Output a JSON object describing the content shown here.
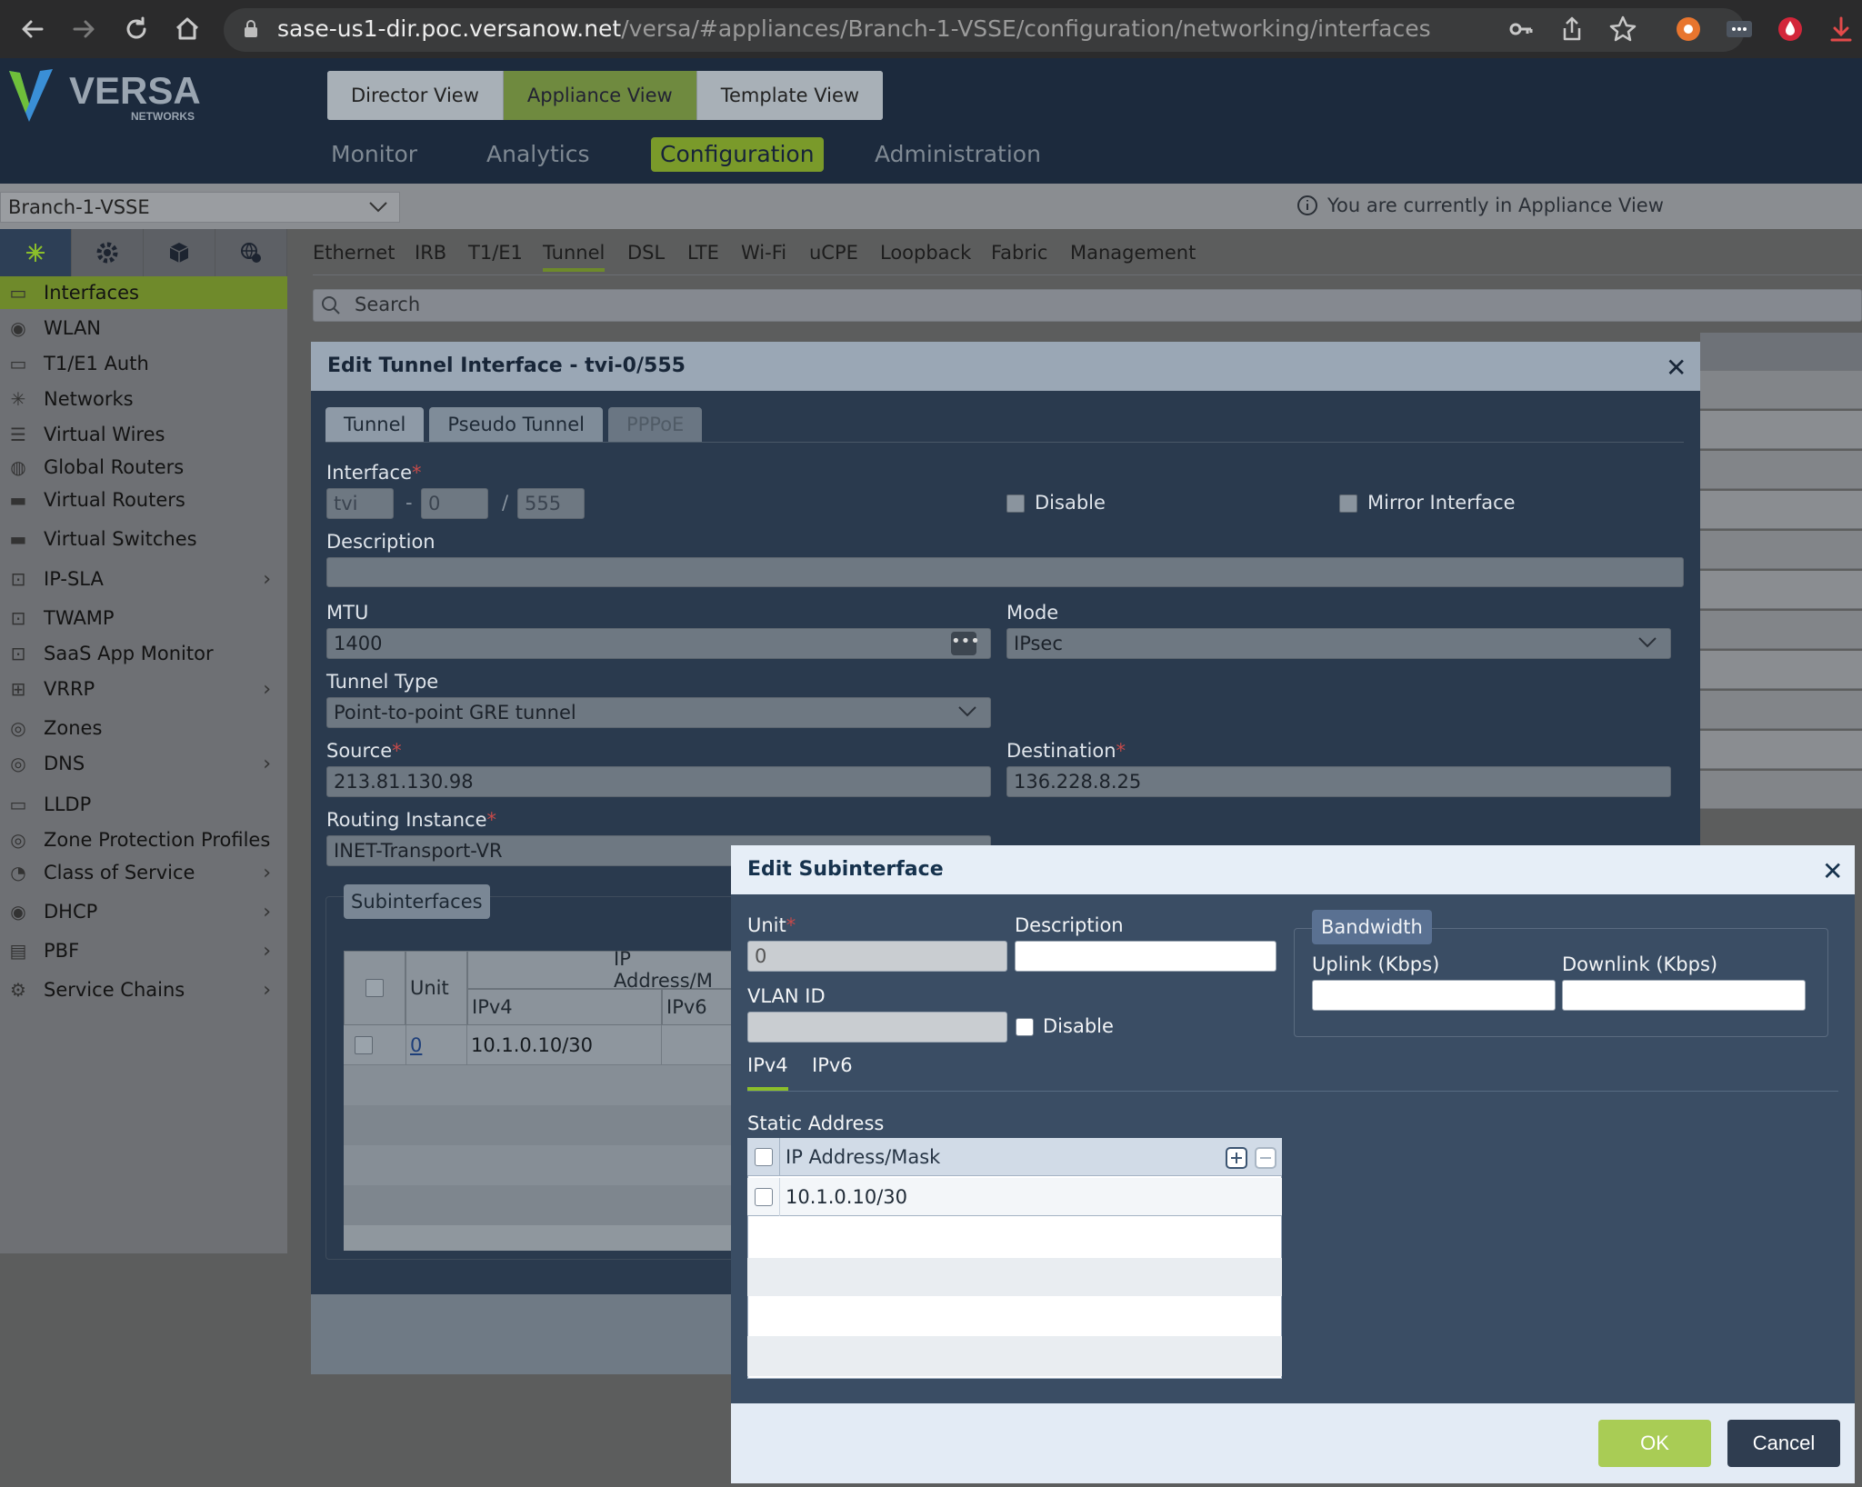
{
  "browser": {
    "url_host": "sase-us1-dir.poc.versanow.net",
    "url_path": "/versa/#appliances/Branch-1-VSSE/configuration/networking/interfaces"
  },
  "app": {
    "logo_text": "VERSA",
    "logo_sub": "NETWORKS",
    "views": [
      "Director View",
      "Appliance View",
      "Template View"
    ],
    "active_view": "Appliance View",
    "main_nav": [
      "Monitor",
      "Analytics",
      "Configuration",
      "Administration"
    ],
    "active_nav": "Configuration",
    "appliance": "Branch-1-VSSE",
    "notice": "You are currently in Appliance View"
  },
  "sidebar": {
    "icons": [
      "network-icon",
      "gear-icon",
      "cube-icon",
      "globe-gear-icon"
    ],
    "items": [
      {
        "label": "Interfaces",
        "active": true
      },
      {
        "label": "WLAN"
      },
      {
        "label": "T1/E1 Auth"
      },
      {
        "label": "Networks"
      },
      {
        "label": "Virtual Wires"
      },
      {
        "label": "Global Routers"
      },
      {
        "label": "Virtual Routers"
      },
      {
        "label": "Virtual Switches"
      },
      {
        "label": "IP-SLA",
        "expandable": true
      },
      {
        "label": "TWAMP"
      },
      {
        "label": "SaaS App Monitor"
      },
      {
        "label": "VRRP",
        "expandable": true
      },
      {
        "label": "Zones"
      },
      {
        "label": "DNS",
        "expandable": true
      },
      {
        "label": "LLDP"
      },
      {
        "label": "Zone Protection Profiles"
      },
      {
        "label": "Class of Service",
        "expandable": true
      },
      {
        "label": "DHCP",
        "expandable": true
      },
      {
        "label": "PBF",
        "expandable": true
      },
      {
        "label": "Service Chains",
        "expandable": true
      }
    ]
  },
  "content": {
    "tabs": [
      "Ethernet",
      "IRB",
      "T1/E1",
      "Tunnel",
      "DSL",
      "LTE",
      "Wi-Fi",
      "uCPE",
      "Loopback",
      "Fabric",
      "Management"
    ],
    "active_tab": "Tunnel",
    "search_placeholder": "Search"
  },
  "tunnel_dialog": {
    "title": "Edit Tunnel Interface - tvi-0/555",
    "tabs": [
      "Tunnel",
      "Pseudo Tunnel",
      "PPPoE"
    ],
    "interface_label": "Interface",
    "interface_prefix": "tvi",
    "interface_sep1": "-",
    "interface_slot": "0",
    "interface_sep2": "/",
    "interface_port": "555",
    "disable_label": "Disable",
    "mirror_label": "Mirror Interface",
    "description_label": "Description",
    "description_value": "",
    "mtu_label": "MTU",
    "mtu_value": "1400",
    "mode_label": "Mode",
    "mode_value": "IPsec",
    "tunnel_type_label": "Tunnel Type",
    "tunnel_type_value": "Point-to-point GRE tunnel",
    "source_label": "Source",
    "source_value": "213.81.130.98",
    "destination_label": "Destination",
    "destination_value": "136.228.8.25",
    "routing_label": "Routing Instance",
    "routing_value": "INET-Transport-VR",
    "subinterfaces_label": "Subinterfaces",
    "table": {
      "col_unit": "Unit",
      "col_ip_group": "IP Address/M",
      "col_ipv4": "IPv4",
      "col_ipv6": "IPv6",
      "rows": [
        {
          "unit": "0",
          "ipv4": "10.1.0.10/30",
          "ipv6": ""
        }
      ]
    }
  },
  "sub_dialog": {
    "title": "Edit Subinterface",
    "unit_label": "Unit",
    "unit_value": "0",
    "description_label": "Description",
    "vlan_label": "VLAN ID",
    "disable_label": "Disable",
    "bandwidth_label": "Bandwidth",
    "uplink_label": "Uplink (Kbps)",
    "downlink_label": "Downlink (Kbps)",
    "tabs": [
      "IPv4",
      "IPv6"
    ],
    "active_tab": "IPv4",
    "static_label": "Static Address",
    "table_header": "IP Address/Mask",
    "rows": [
      "10.1.0.10/30"
    ],
    "ok_label": "OK",
    "cancel_label": "Cancel"
  },
  "colors": {
    "accent_green": "#7a9a2a",
    "header_navy": "#1c2a3d",
    "ok_green": "#a9cc55"
  }
}
